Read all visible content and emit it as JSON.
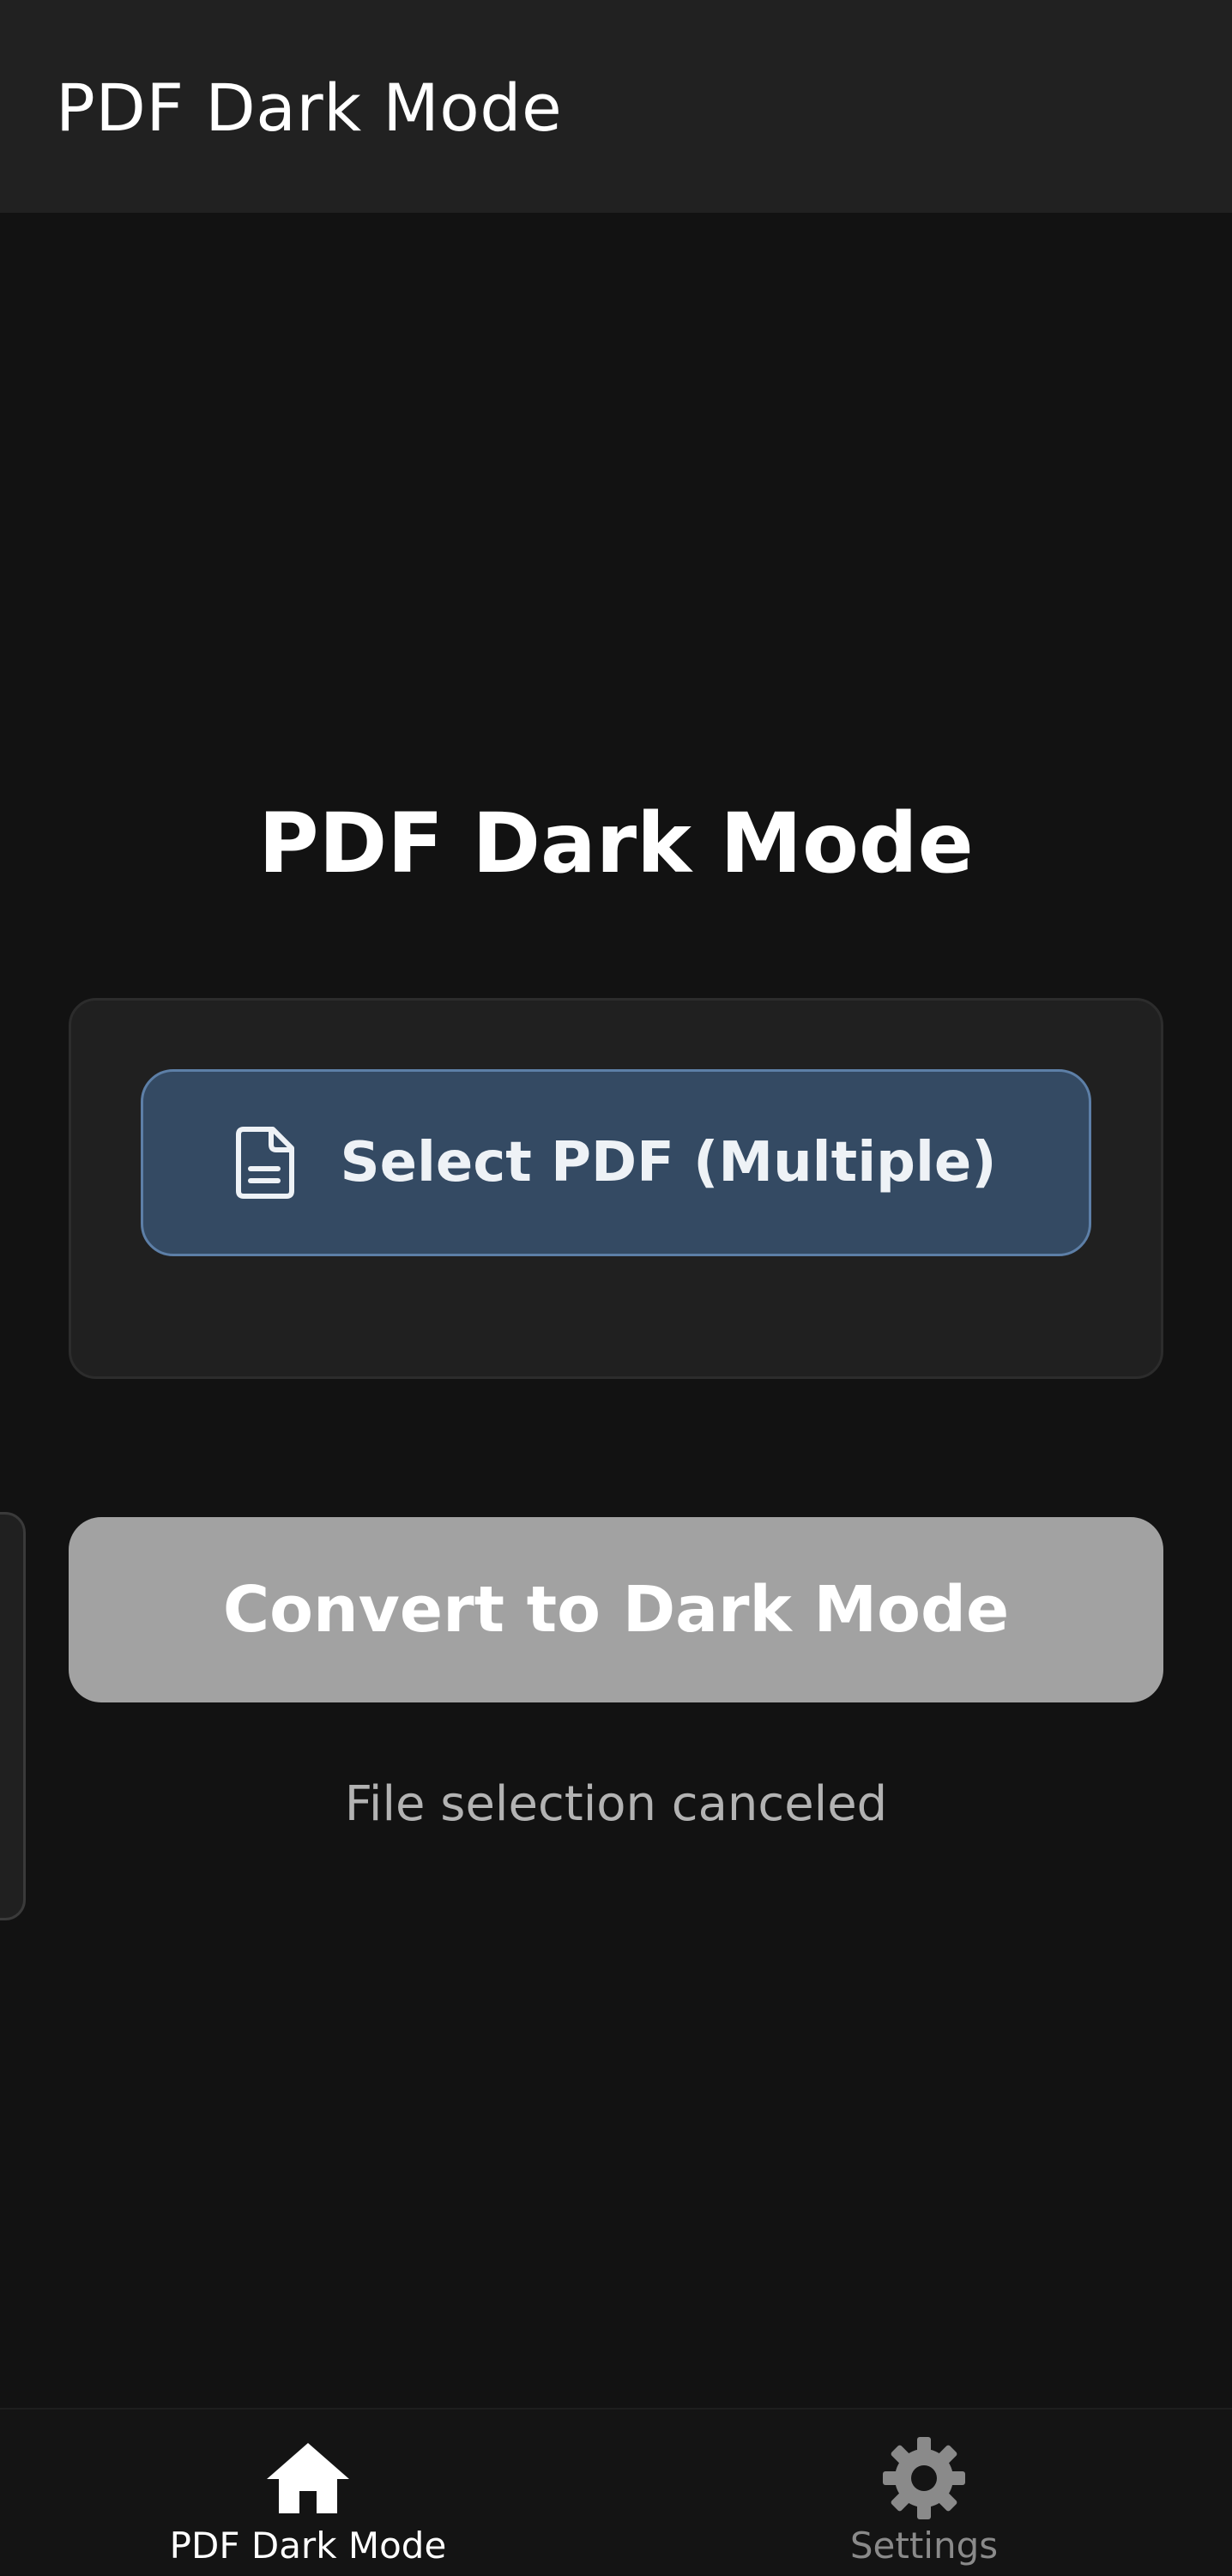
{
  "app_bar": {
    "title": "PDF Dark Mode"
  },
  "main": {
    "heading": "PDF Dark Mode",
    "select_button": {
      "label": "Select PDF (Multiple)",
      "icon": "document-icon"
    },
    "convert_button": {
      "label": "Convert to Dark Mode",
      "enabled": false
    },
    "status": "File selection canceled"
  },
  "bottom_nav": {
    "items": [
      {
        "label": "PDF Dark Mode",
        "icon": "home-icon",
        "active": true
      },
      {
        "label": "Settings",
        "icon": "gear-icon",
        "active": false
      }
    ]
  },
  "colors": {
    "background": "#121212",
    "app_bar": "#212121",
    "card": "#202020",
    "select_button_fill": "#344a63",
    "select_button_border": "#5d7fa7",
    "convert_button_disabled": "#a2a2a2",
    "status_text": "#b3b3b3",
    "nav_active": "#ffffff",
    "nav_inactive": "#8a8a8a"
  }
}
